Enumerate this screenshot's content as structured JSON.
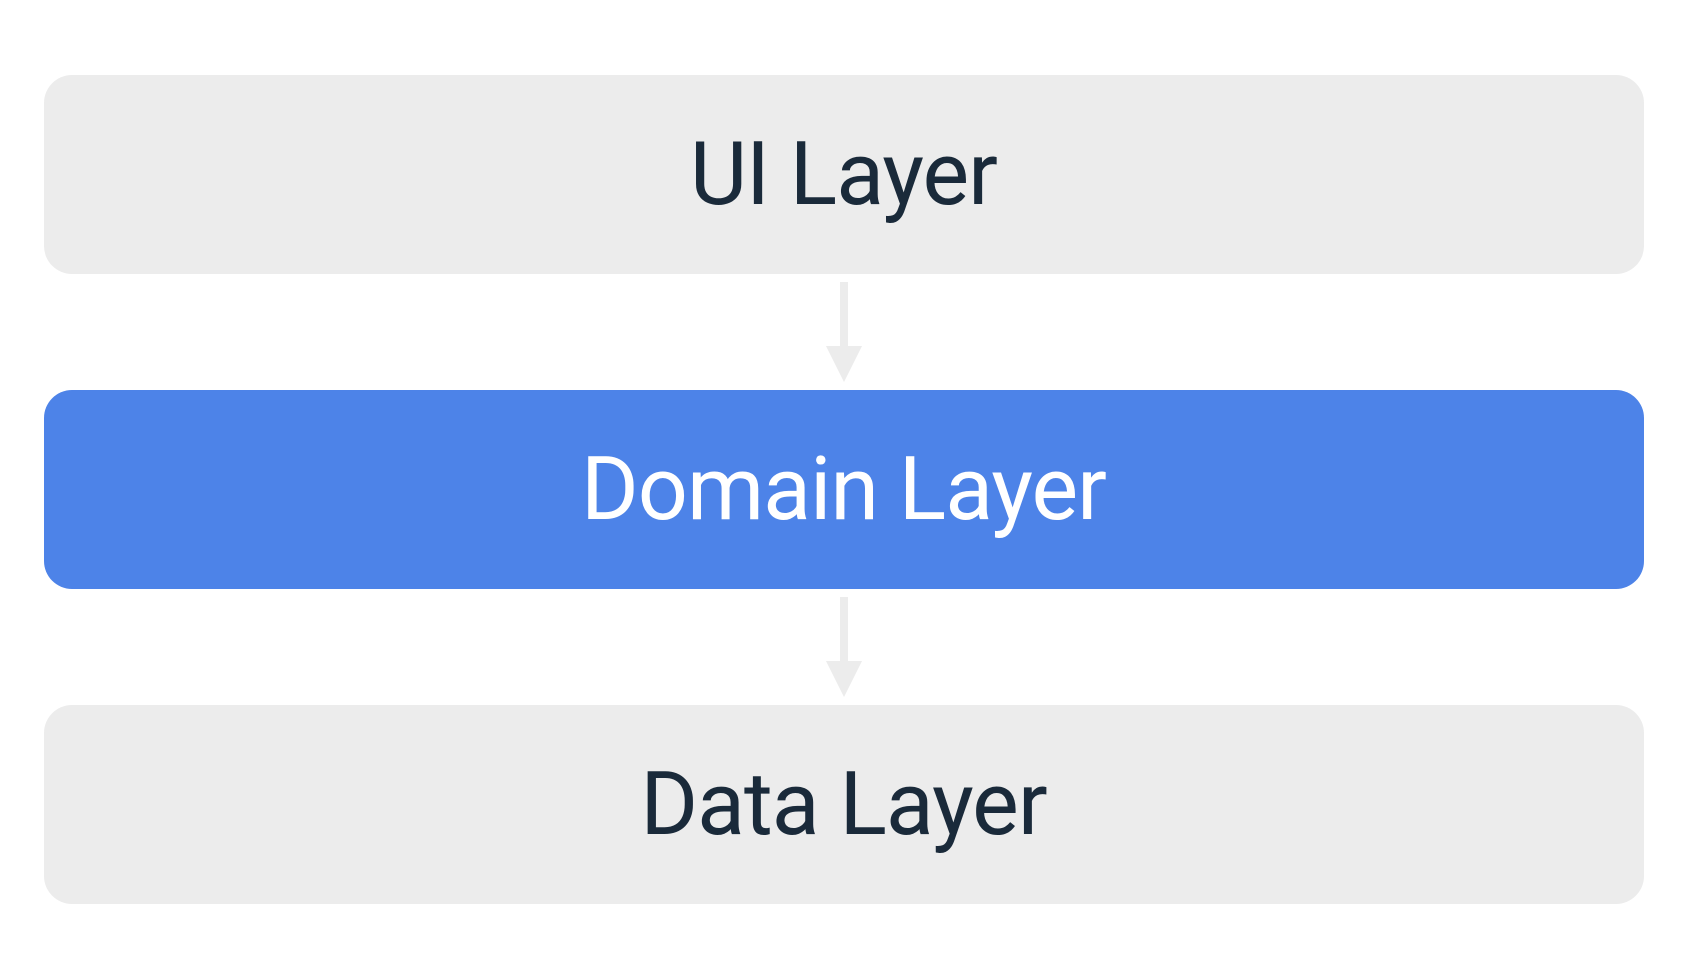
{
  "diagram": {
    "layers": [
      {
        "id": "ui-layer",
        "label": "UI Layer",
        "highlighted": false
      },
      {
        "id": "domain-layer",
        "label": "Domain Layer",
        "highlighted": true
      },
      {
        "id": "data-layer",
        "label": "Data Layer",
        "highlighted": false
      }
    ],
    "colors": {
      "neutral_bg": "#ececec",
      "neutral_text": "#1a2a3a",
      "highlight_bg": "#4d83e8",
      "highlight_text": "#ffffff",
      "arrow": "#ececec"
    }
  }
}
